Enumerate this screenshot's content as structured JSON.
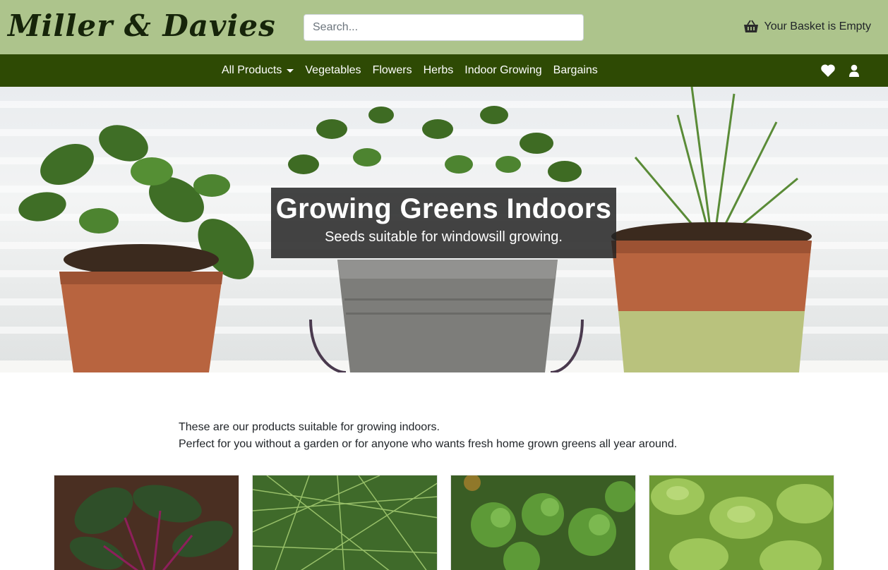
{
  "header": {
    "logo_text": "Miller & Davies",
    "search_placeholder": "Search...",
    "basket_label": "Your Basket is Empty",
    "basket_icon": "basket-icon"
  },
  "nav": {
    "items": [
      {
        "label": "All Products",
        "has_dropdown": true
      },
      {
        "label": "Vegetables"
      },
      {
        "label": "Flowers"
      },
      {
        "label": "Herbs"
      },
      {
        "label": "Indoor Growing"
      },
      {
        "label": "Bargains"
      }
    ],
    "icons": [
      "heart-icon",
      "user-icon"
    ]
  },
  "hero": {
    "title": "Growing Greens Indoors",
    "subtitle": "Seeds suitable for windowsill growing."
  },
  "intro": {
    "line1": "These are our products suitable for growing indoors.",
    "line2": "Perfect for you without a garden or for anyone who wants fresh home grown greens all year around."
  },
  "products": [
    {
      "image": "beetroot-leaves-image"
    },
    {
      "image": "dill-image"
    },
    {
      "image": "curly-kale-image"
    },
    {
      "image": "lettuce-image"
    }
  ],
  "colors": {
    "header_bg": "#adc48c",
    "nav_bg": "#2e4a04",
    "logo": "#16240a"
  }
}
